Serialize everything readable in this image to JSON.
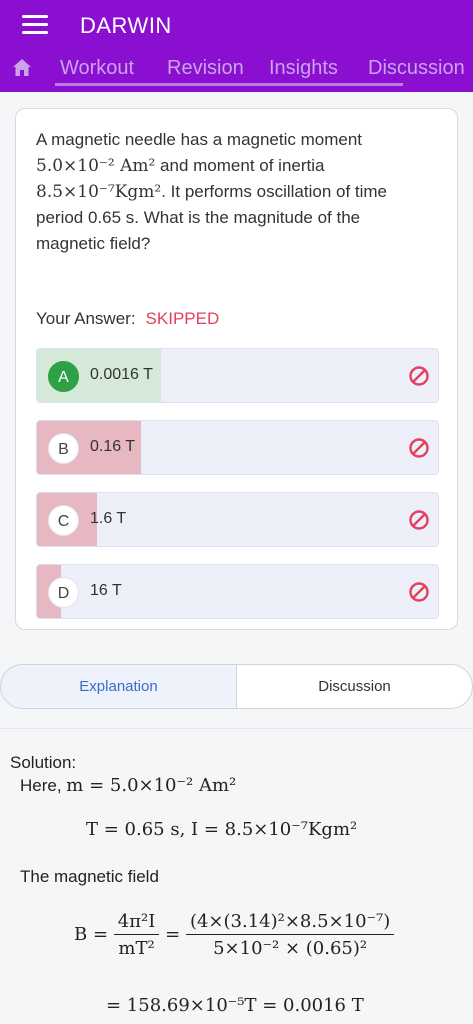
{
  "header": {
    "app_title": "DARWIN",
    "tabs": [
      "Workout",
      "Revision",
      "Insights",
      "Discussion"
    ]
  },
  "question": {
    "line1": "A magnetic needle has a magnetic moment",
    "moment": "5.0×10⁻² Am²",
    "line2_suffix": " and moment of inertia",
    "inertia": "8.5×10⁻⁷Kgm²",
    "line3_suffix": ". It performs oscillation of time",
    "line4": "period 0.65 s. What is the magnitude of the",
    "line5": "magnetic field?"
  },
  "answer": {
    "label": "Your Answer:",
    "status": "SKIPPED"
  },
  "options": [
    {
      "letter": "A",
      "text": "0.0016 T",
      "share": 0.31,
      "correct": true
    },
    {
      "letter": "B",
      "text": "0.16 T",
      "share": 0.26,
      "correct": false
    },
    {
      "letter": "C",
      "text": "1.6 T",
      "share": 0.15,
      "correct": false
    },
    {
      "letter": "D",
      "text": "16 T",
      "share": 0.06,
      "correct": false
    }
  ],
  "colors": {
    "correct_fill": "#d4e9d8",
    "wrong_fill": "#e8b8c2",
    "accent": "#8a0fd0",
    "ban": "#e0415d"
  },
  "segment": {
    "explanation": "Explanation",
    "discussion": "Discussion"
  },
  "solution": {
    "title": "Solution:",
    "here_label": "Here, ",
    "here_math": "m  =  5.0×10⁻² Am²",
    "line2": "T  =  0.65 s,  I  =  8.5×10⁻⁷Kgm²",
    "field_text": "The magnetic field",
    "b_lhs": "B =",
    "frac1_num": "4π²I",
    "frac1_den": "mT²",
    "eq": "=",
    "frac2_num": "(4×(3.14)²×8.5×10⁻⁷)",
    "frac2_den": "5×10⁻² × (0.65)²",
    "result": "= 158.69×10⁻⁵T = 0.0016 T"
  }
}
